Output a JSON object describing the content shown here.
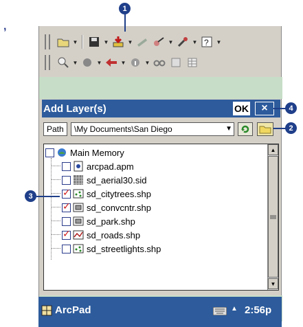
{
  "callouts": [
    "1",
    "2",
    "3",
    "4"
  ],
  "corner_mark": ",",
  "toolbar_row1": [
    "open-file-icon",
    "save-icon",
    "add-layer-icon",
    "gps-icon",
    "pen-icon",
    "tools-icon",
    "help-icon"
  ],
  "toolbar_row2": [
    "zoom-icon",
    "pan-icon",
    "back-arrow-icon",
    "identify-icon",
    "find-icon",
    "layer-list-icon",
    "table-icon"
  ],
  "dialog": {
    "title": "Add Layer(s)",
    "ok_label": "OK",
    "close_label": "×",
    "path_label": "Path",
    "path_value": "\\My Documents\\San Diego"
  },
  "tree": {
    "root": {
      "label": "Main Memory",
      "checked": false,
      "icon": "device-icon"
    },
    "items": [
      {
        "label": "arcpad.apm",
        "checked": false,
        "icon": "settings-file-icon"
      },
      {
        "label": "sd_aerial30.sid",
        "checked": false,
        "icon": "raster-file-icon"
      },
      {
        "label": "sd_citytrees.shp",
        "checked": true,
        "icon": "point-shapefile-icon"
      },
      {
        "label": "sd_convcntr.shp",
        "checked": true,
        "icon": "polygon-shapefile-icon"
      },
      {
        "label": "sd_park.shp",
        "checked": false,
        "icon": "polygon-shapefile-icon"
      },
      {
        "label": "sd_roads.shp",
        "checked": true,
        "icon": "line-shapefile-icon"
      },
      {
        "label": "sd_streetlights.shp",
        "checked": false,
        "icon": "point-shapefile-icon"
      }
    ]
  },
  "taskbar": {
    "app_name": "ArcPad",
    "time": "2:56p"
  },
  "colors": {
    "titlebar": "#2d5b9c",
    "callout": "#1f3f8a",
    "check": "#d11d1d",
    "map_background": "#c7ddc7"
  }
}
